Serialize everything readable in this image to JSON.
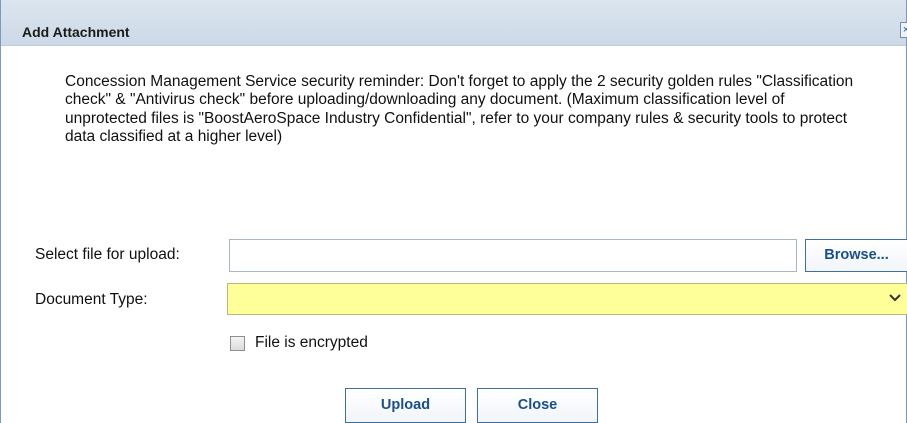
{
  "dialog": {
    "title": "Add Attachment",
    "close_icon": "close-icon",
    "reminder": "Concession Management Service security reminder: Don't forget to apply the 2 security golden rules \"Classification check\" & \"Antivirus check\" before uploading/downloading any document. (Maximum classification level of unprotected files is \"BoostAeroSpace Industry Confidential\", refer to your company rules & security tools to protect data classified at a higher level)"
  },
  "form": {
    "file_label": "Select file for upload:",
    "file_value": "",
    "browse_label": "Browse...",
    "doc_type_label": "Document Type:",
    "doc_type_value": "",
    "doc_type_dropdown_icon": "chevron-down-icon",
    "doc_type_color": "#ffff99",
    "encrypted_label": "File is encrypted",
    "encrypted_checked": false
  },
  "actions": {
    "upload_label": "Upload",
    "close_label": "Close"
  }
}
